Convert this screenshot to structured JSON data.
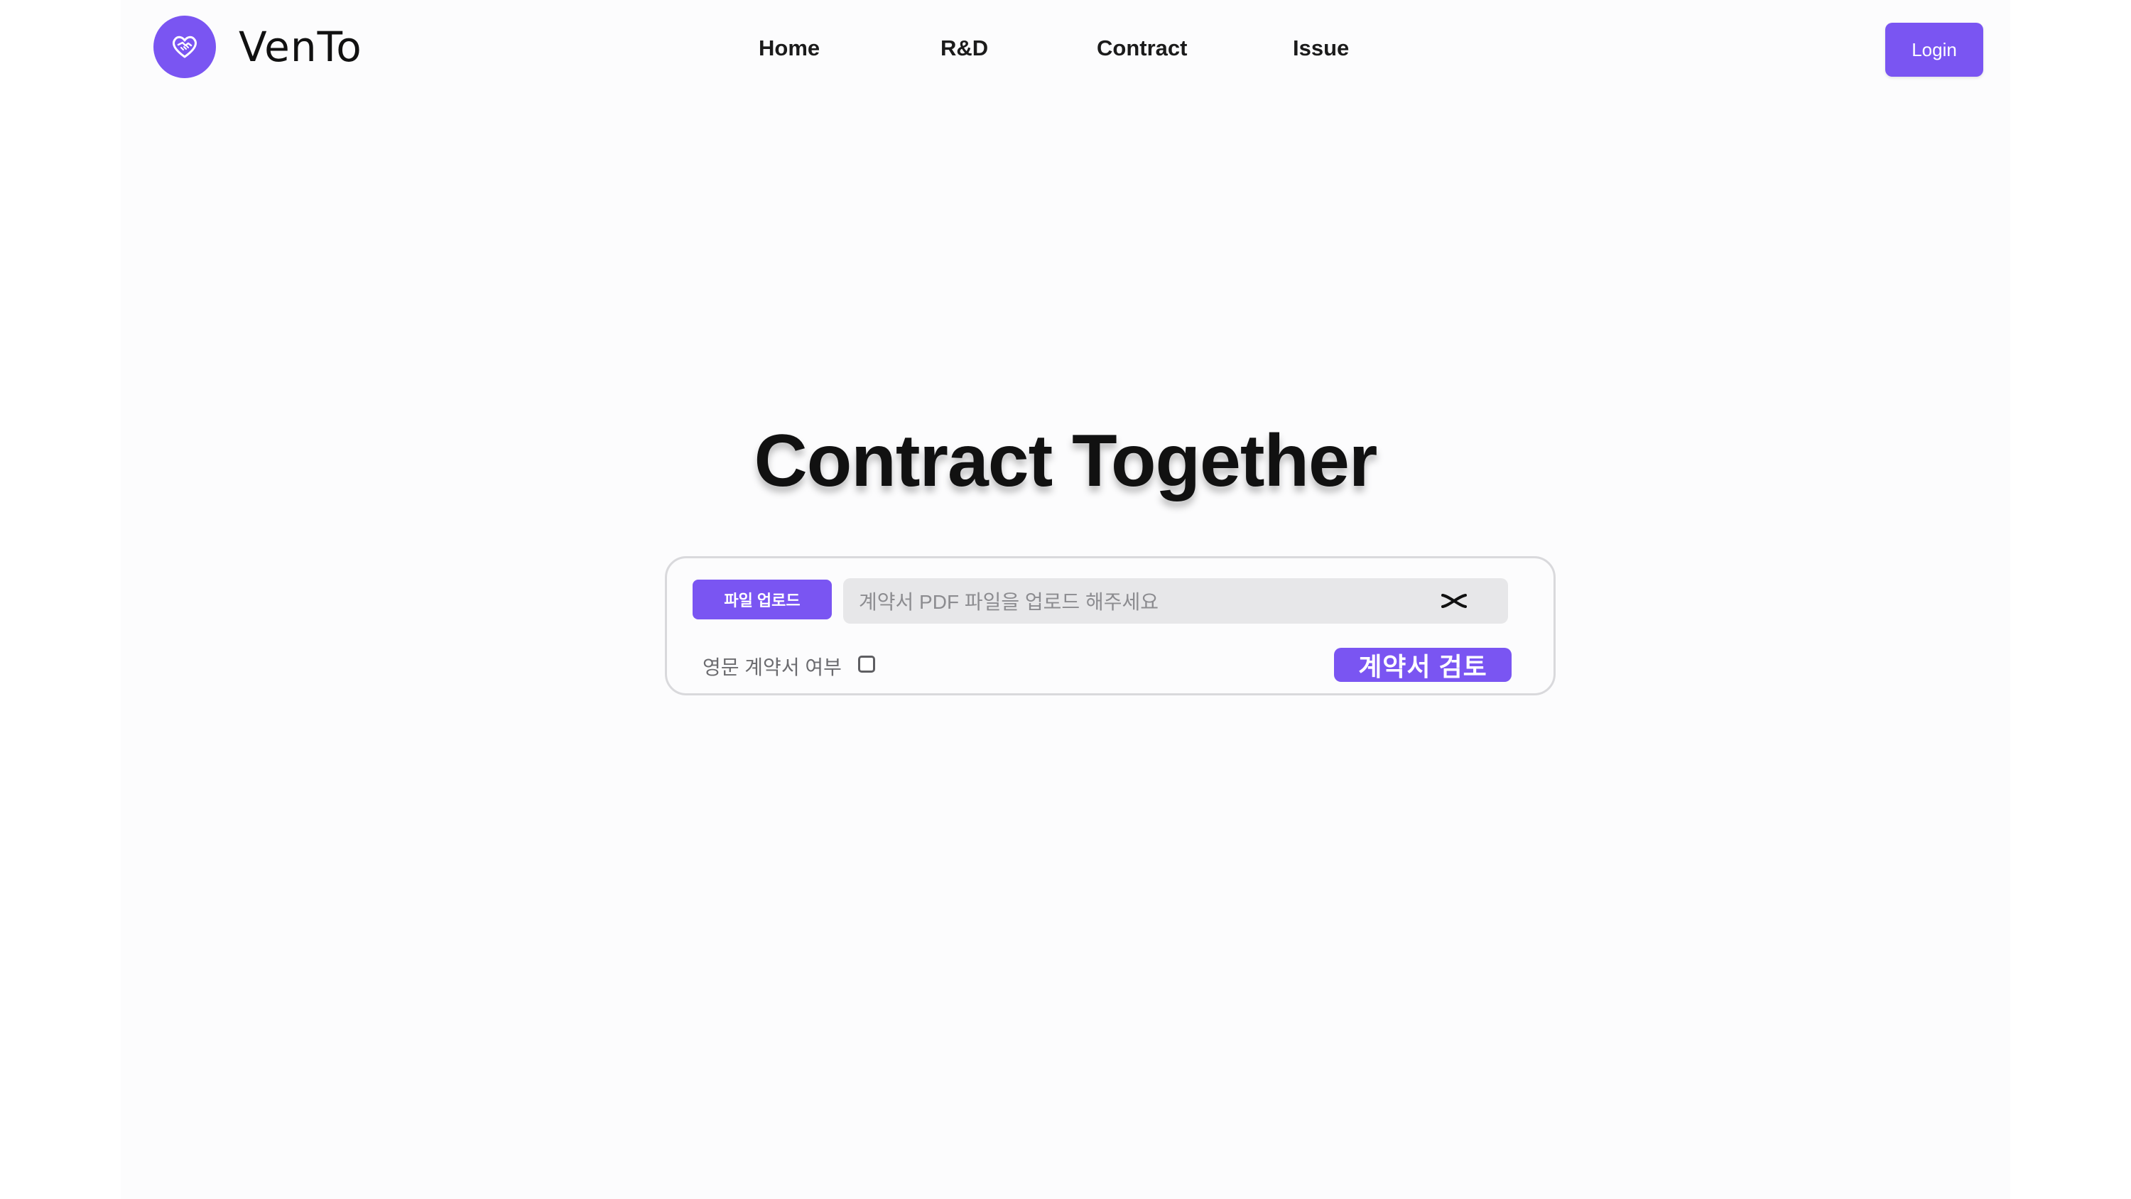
{
  "brand": {
    "name": "VenTo",
    "logo_icon": "heart-handshake-icon",
    "accent_color": "#7a55f2"
  },
  "nav": {
    "items": [
      {
        "label": "Home"
      },
      {
        "label": "R&D"
      },
      {
        "label": "Contract"
      },
      {
        "label": "Issue"
      }
    ]
  },
  "header": {
    "login_label": "Login"
  },
  "hero": {
    "title": "Contract Together"
  },
  "upload": {
    "upload_button_label": "파일 업로드",
    "file_placeholder": "계약서 PDF 파일을 업로드 해주세요",
    "clear_icon": "close-icon",
    "english_contract_label": "영문 계약서 여부",
    "english_contract_checked": false,
    "review_button_label": "계약서 검토"
  }
}
